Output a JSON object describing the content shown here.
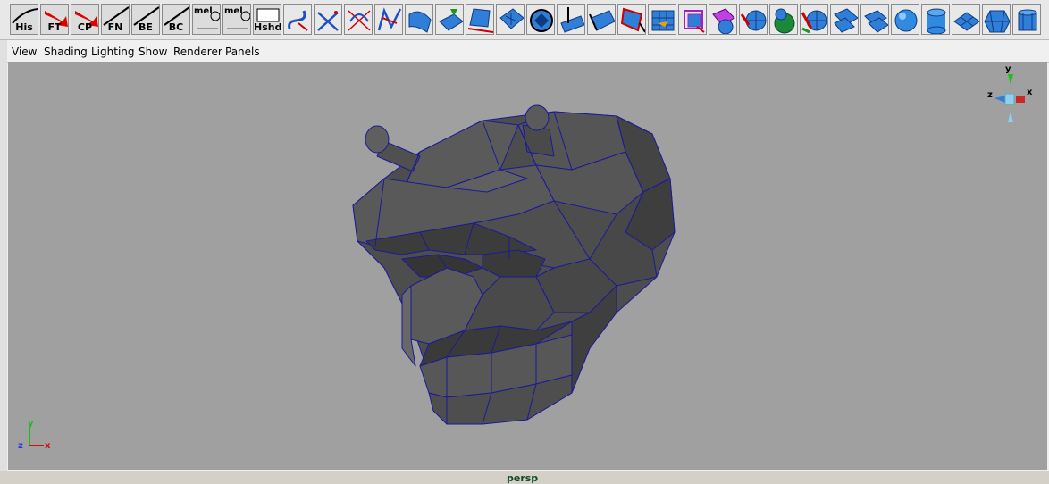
{
  "shelf": {
    "buttons": [
      {
        "name": "history",
        "label": "His"
      },
      {
        "name": "freeze-transform",
        "label": "FT"
      },
      {
        "name": "center-pivot",
        "label": "CP"
      },
      {
        "name": "face-normals",
        "label": "FN"
      },
      {
        "name": "border-edges",
        "label": "BE"
      },
      {
        "name": "backface-culling",
        "label": "BC"
      },
      {
        "name": "mel-script-1",
        "label": "mel"
      },
      {
        "name": "mel-script-2",
        "label": "mel"
      },
      {
        "name": "hardware-shade",
        "label": "Hshd"
      }
    ],
    "tool_icons": [
      "cv-curve-icon",
      "ep-curve-icon",
      "pencil-curve-icon",
      "arc-tool-icon",
      "revolve-icon",
      "loft-icon",
      "planar-icon",
      "extrude-icon",
      "bevel-icon",
      "project-curve-icon",
      "trim-icon",
      "attach-surface-icon",
      "rebuild-surface-icon",
      "lattice-icon",
      "cluster-icon",
      "sculpt-icon",
      "sphere-icon",
      "sphere-green-icon",
      "extract-icon",
      "subdiv-icon",
      "plane-icon",
      "sphere-primitive-icon",
      "cylinder-icon",
      "poly-plane-icon",
      "poly-soccer-ball-icon",
      "poly-cylinder-icon"
    ]
  },
  "panel": {
    "menus": [
      "View",
      "Shading",
      "Lighting",
      "Show",
      "Renderer",
      "Panels"
    ],
    "camera_label": "persp"
  },
  "axes": {
    "top_right": {
      "x": "x",
      "y": "y",
      "z": "z"
    },
    "bottom_left": {
      "x": "x",
      "y": "y",
      "z": "z"
    }
  },
  "colors": {
    "viewport_bg": "#a0a0a0",
    "mesh_face": "#505050",
    "wireframe": "#1a1a9a"
  }
}
